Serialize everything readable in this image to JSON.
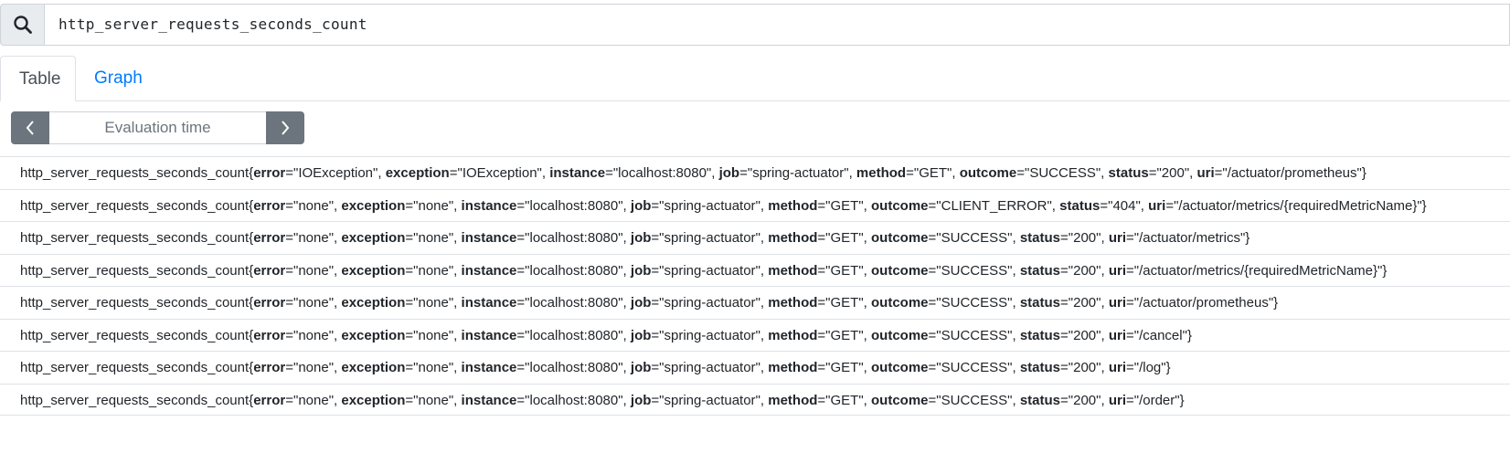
{
  "query": {
    "value": "http_server_requests_seconds_count"
  },
  "tabs": [
    {
      "label": "Table"
    },
    {
      "label": "Graph"
    }
  ],
  "evaluation": {
    "placeholder": "Evaluation time"
  },
  "metric": "http_server_requests_seconds_count",
  "results": [
    {
      "labels": [
        {
          "k": "error",
          "v": "IOException"
        },
        {
          "k": "exception",
          "v": "IOException"
        },
        {
          "k": "instance",
          "v": "localhost:8080"
        },
        {
          "k": "job",
          "v": "spring-actuator"
        },
        {
          "k": "method",
          "v": "GET"
        },
        {
          "k": "outcome",
          "v": "SUCCESS"
        },
        {
          "k": "status",
          "v": "200"
        },
        {
          "k": "uri",
          "v": "/actuator/prometheus"
        }
      ]
    },
    {
      "labels": [
        {
          "k": "error",
          "v": "none"
        },
        {
          "k": "exception",
          "v": "none"
        },
        {
          "k": "instance",
          "v": "localhost:8080"
        },
        {
          "k": "job",
          "v": "spring-actuator"
        },
        {
          "k": "method",
          "v": "GET"
        },
        {
          "k": "outcome",
          "v": "CLIENT_ERROR"
        },
        {
          "k": "status",
          "v": "404"
        },
        {
          "k": "uri",
          "v": "/actuator/metrics/{requiredMetricName}"
        }
      ]
    },
    {
      "labels": [
        {
          "k": "error",
          "v": "none"
        },
        {
          "k": "exception",
          "v": "none"
        },
        {
          "k": "instance",
          "v": "localhost:8080"
        },
        {
          "k": "job",
          "v": "spring-actuator"
        },
        {
          "k": "method",
          "v": "GET"
        },
        {
          "k": "outcome",
          "v": "SUCCESS"
        },
        {
          "k": "status",
          "v": "200"
        },
        {
          "k": "uri",
          "v": "/actuator/metrics"
        }
      ]
    },
    {
      "labels": [
        {
          "k": "error",
          "v": "none"
        },
        {
          "k": "exception",
          "v": "none"
        },
        {
          "k": "instance",
          "v": "localhost:8080"
        },
        {
          "k": "job",
          "v": "spring-actuator"
        },
        {
          "k": "method",
          "v": "GET"
        },
        {
          "k": "outcome",
          "v": "SUCCESS"
        },
        {
          "k": "status",
          "v": "200"
        },
        {
          "k": "uri",
          "v": "/actuator/metrics/{requiredMetricName}"
        }
      ]
    },
    {
      "labels": [
        {
          "k": "error",
          "v": "none"
        },
        {
          "k": "exception",
          "v": "none"
        },
        {
          "k": "instance",
          "v": "localhost:8080"
        },
        {
          "k": "job",
          "v": "spring-actuator"
        },
        {
          "k": "method",
          "v": "GET"
        },
        {
          "k": "outcome",
          "v": "SUCCESS"
        },
        {
          "k": "status",
          "v": "200"
        },
        {
          "k": "uri",
          "v": "/actuator/prometheus"
        }
      ]
    },
    {
      "labels": [
        {
          "k": "error",
          "v": "none"
        },
        {
          "k": "exception",
          "v": "none"
        },
        {
          "k": "instance",
          "v": "localhost:8080"
        },
        {
          "k": "job",
          "v": "spring-actuator"
        },
        {
          "k": "method",
          "v": "GET"
        },
        {
          "k": "outcome",
          "v": "SUCCESS"
        },
        {
          "k": "status",
          "v": "200"
        },
        {
          "k": "uri",
          "v": "/cancel"
        }
      ]
    },
    {
      "labels": [
        {
          "k": "error",
          "v": "none"
        },
        {
          "k": "exception",
          "v": "none"
        },
        {
          "k": "instance",
          "v": "localhost:8080"
        },
        {
          "k": "job",
          "v": "spring-actuator"
        },
        {
          "k": "method",
          "v": "GET"
        },
        {
          "k": "outcome",
          "v": "SUCCESS"
        },
        {
          "k": "status",
          "v": "200"
        },
        {
          "k": "uri",
          "v": "/log"
        }
      ]
    },
    {
      "labels": [
        {
          "k": "error",
          "v": "none"
        },
        {
          "k": "exception",
          "v": "none"
        },
        {
          "k": "instance",
          "v": "localhost:8080"
        },
        {
          "k": "job",
          "v": "spring-actuator"
        },
        {
          "k": "method",
          "v": "GET"
        },
        {
          "k": "outcome",
          "v": "SUCCESS"
        },
        {
          "k": "status",
          "v": "200"
        },
        {
          "k": "uri",
          "v": "/order"
        }
      ]
    }
  ],
  "icons": {
    "search": "search-icon",
    "prev": "chevron-left-icon",
    "next": "chevron-right-icon"
  },
  "colors": {
    "accent": "#007bff",
    "nav_button": "#6c757d"
  }
}
